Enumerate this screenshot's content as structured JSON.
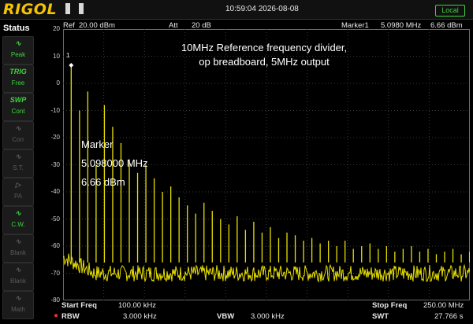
{
  "brand": {
    "logo": "RIGOL"
  },
  "status_bar": {
    "timestamp": "10:59:04 2026-08-08",
    "local_badge": "Local"
  },
  "info_row": {
    "ref_label": "Ref",
    "ref_value": "20.00 dBm",
    "att_label": "Att",
    "att_value": "20 dB",
    "marker_label": "Marker1",
    "marker_freq": "5.0980 MHz",
    "marker_level": "6.66 dBm"
  },
  "left_panel": {
    "title": "Status",
    "buttons": [
      {
        "icon": "peak-icon",
        "glyph": "∿",
        "label": "Peak",
        "active": true
      },
      {
        "icon": "trig-icon",
        "glyph": "TRIG",
        "label": "Free",
        "active": true
      },
      {
        "icon": "swp-icon",
        "glyph": "SWP",
        "label": "Cont",
        "active": true
      },
      {
        "icon": "corr-icon",
        "glyph": "∿",
        "label": "Corr",
        "active": false
      },
      {
        "icon": "st-icon",
        "glyph": "∿",
        "label": "S.T.",
        "active": false
      },
      {
        "icon": "pa-icon",
        "glyph": "▷",
        "label": "PA",
        "active": false
      },
      {
        "icon": "cw-icon",
        "glyph": "∿",
        "label": "C.W.",
        "active": true
      },
      {
        "icon": "blank-icon",
        "glyph": "∿",
        "label": "Blank",
        "active": false
      },
      {
        "icon": "blank2-icon",
        "glyph": "∿",
        "label": "Blank",
        "active": false
      },
      {
        "icon": "math-icon",
        "glyph": "∿",
        "label": "Math",
        "active": false
      }
    ]
  },
  "plot": {
    "annotation_line1": "10MHz Reference frequency divider,",
    "annotation_line2": "op breadboard, 5MHz output",
    "marker_title": "Marker",
    "marker_freq": "5.098000 MHz",
    "marker_level": "6.66 dBm",
    "marker_flag": "1",
    "y_ticks": [
      "20",
      "10",
      "0",
      "-10",
      "-20",
      "-30",
      "-40",
      "-50",
      "-60",
      "-70",
      "-80"
    ],
    "trace_color": "#e8e000",
    "ylim": [
      -80,
      20
    ],
    "xlim_mhz": [
      0.1,
      250
    ],
    "noise_floor_dbm": -70,
    "harmonic_spacing_mhz": 5.098,
    "harmonic_peaks_dbm": [
      6.66,
      -10,
      -3,
      -30,
      -8,
      -16,
      -22,
      -28,
      -33,
      -30,
      -35,
      -40,
      -38,
      -42,
      -45,
      -48,
      -44,
      -47,
      -50,
      -52,
      -49,
      -54,
      -51,
      -55,
      -53,
      -57,
      -55,
      -56,
      -58,
      -57,
      -59,
      -58,
      -60,
      -58,
      -61,
      -60,
      -59,
      -61,
      -60,
      -62,
      -61,
      -60,
      -62,
      -61,
      -63,
      -62,
      -61,
      -63,
      -62
    ]
  },
  "bottom": {
    "start_label": "Start Freq",
    "start_value": "100.00 kHz",
    "stop_label": "Stop Freq",
    "stop_value": "250.00 MHz",
    "rbw_label": "RBW",
    "rbw_value": "3.000 kHz",
    "vbw_label": "VBW",
    "vbw_value": "3.000 kHz",
    "swt_label": "SWT",
    "swt_value": "27.766 s"
  }
}
